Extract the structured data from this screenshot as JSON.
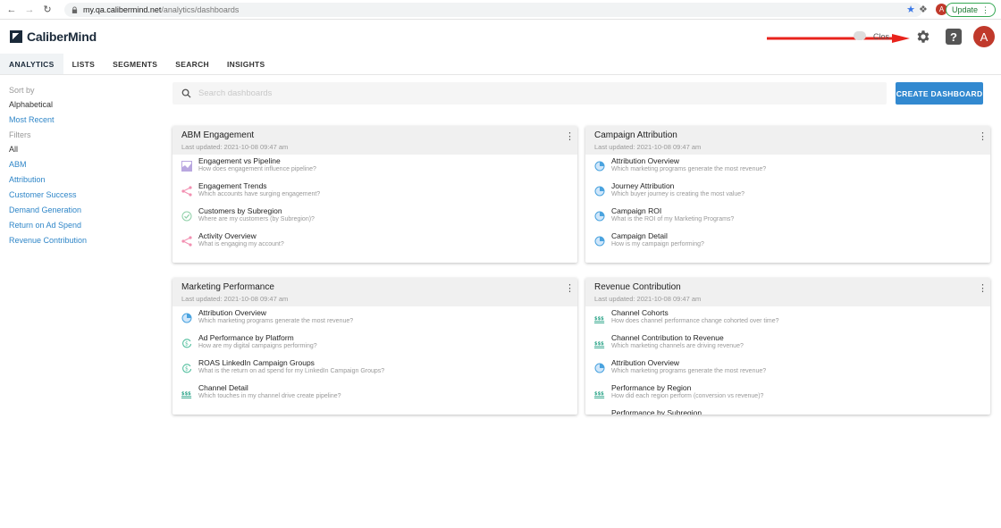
{
  "browser": {
    "host": "my.qa.calibermind.net",
    "path": "/analytics/dashboards",
    "update_label": "Update",
    "avatar_letter": "A"
  },
  "header": {
    "brand": "CaliberMind",
    "toggle_label": "Clos",
    "avatar_letter": "A"
  },
  "tabs": [
    {
      "label": "ANALYTICS"
    },
    {
      "label": "LISTS"
    },
    {
      "label": "SEGMENTS"
    },
    {
      "label": "SEARCH"
    },
    {
      "label": "INSIGHTS"
    }
  ],
  "sidebar": {
    "sort_heading": "Sort by",
    "sort": [
      {
        "label": "Alphabetical"
      },
      {
        "label": "Most Recent"
      }
    ],
    "filter_heading": "Filters",
    "filters": [
      {
        "label": "All"
      },
      {
        "label": "ABM"
      },
      {
        "label": "Attribution"
      },
      {
        "label": "Customer Success"
      },
      {
        "label": "Demand Generation"
      },
      {
        "label": "Return on Ad Spend"
      },
      {
        "label": "Revenue Contribution"
      }
    ]
  },
  "search": {
    "placeholder": "Search dashboards"
  },
  "create_label": "CREATE DASHBOARD",
  "colors": {
    "accent": "#3289d0",
    "link": "#2f86c8",
    "avatar": "#c0392b",
    "arrow": "#e8231c"
  },
  "cards": [
    {
      "title": "ABM Engagement",
      "updated": "Last updated: 2021-10-08 09:47 am",
      "items": [
        {
          "title": "Engagement vs Pipeline",
          "desc": "How does engagement influence pipeline?",
          "icon": "area-chart-icon"
        },
        {
          "title": "Engagement Trends",
          "desc": "Which accounts have surging engagement?",
          "icon": "network-icon"
        },
        {
          "title": "Customers by Subregion",
          "desc": "Where are my customers (by Subregion)?",
          "icon": "check-circle-icon"
        },
        {
          "title": "Activity Overview",
          "desc": "What is engaging my account?",
          "icon": "network-icon"
        }
      ]
    },
    {
      "title": "Campaign Attribution",
      "updated": "Last updated: 2021-10-08 09:47 am",
      "items": [
        {
          "title": "Attribution Overview",
          "desc": "Which marketing programs generate the most revenue?",
          "icon": "pie-chart-icon"
        },
        {
          "title": "Journey Attribution",
          "desc": "Which buyer journey is creating the most value?",
          "icon": "pie-chart-icon"
        },
        {
          "title": "Campaign ROI",
          "desc": "What is the ROI of my Marketing Programs?",
          "icon": "pie-chart-icon"
        },
        {
          "title": "Campaign Detail",
          "desc": "How is my campaign performing?",
          "icon": "pie-chart-icon"
        }
      ]
    },
    {
      "title": "Marketing Performance",
      "updated": "Last updated: 2021-10-08 09:47 am",
      "items": [
        {
          "title": "Attribution Overview",
          "desc": "Which marketing programs generate the most revenue?",
          "icon": "pie-chart-icon"
        },
        {
          "title": "Ad Performance by Platform",
          "desc": "How are my digital campaigns performing?",
          "icon": "dollar-cycle-icon"
        },
        {
          "title": "ROAS LinkedIn Campaign Groups",
          "desc": "What is the return on ad spend for my LinkedIn Campaign Groups?",
          "icon": "dollar-cycle-icon"
        },
        {
          "title": "Channel Detail",
          "desc": "Which touches in my channel drive create pipeline?",
          "icon": "dollar-stack-icon"
        }
      ]
    },
    {
      "title": "Revenue Contribution",
      "updated": "Last updated: 2021-10-08 09:47 am",
      "items": [
        {
          "title": "Channel Cohorts",
          "desc": "How does channel performance change cohorted over time?",
          "icon": "dollar-stack-icon"
        },
        {
          "title": "Channel Contribution to Revenue",
          "desc": "Which marketing channels are driving revenue?",
          "icon": "dollar-stack-icon"
        },
        {
          "title": "Attribution Overview",
          "desc": "Which marketing programs generate the most revenue?",
          "icon": "pie-chart-icon"
        },
        {
          "title": "Performance by Region",
          "desc": "How did each region perform (conversion vs revenue)?",
          "icon": "dollar-stack-icon"
        },
        {
          "title": "Performance by Subregion",
          "desc": "",
          "icon": "dollar-stack-icon"
        }
      ]
    }
  ]
}
